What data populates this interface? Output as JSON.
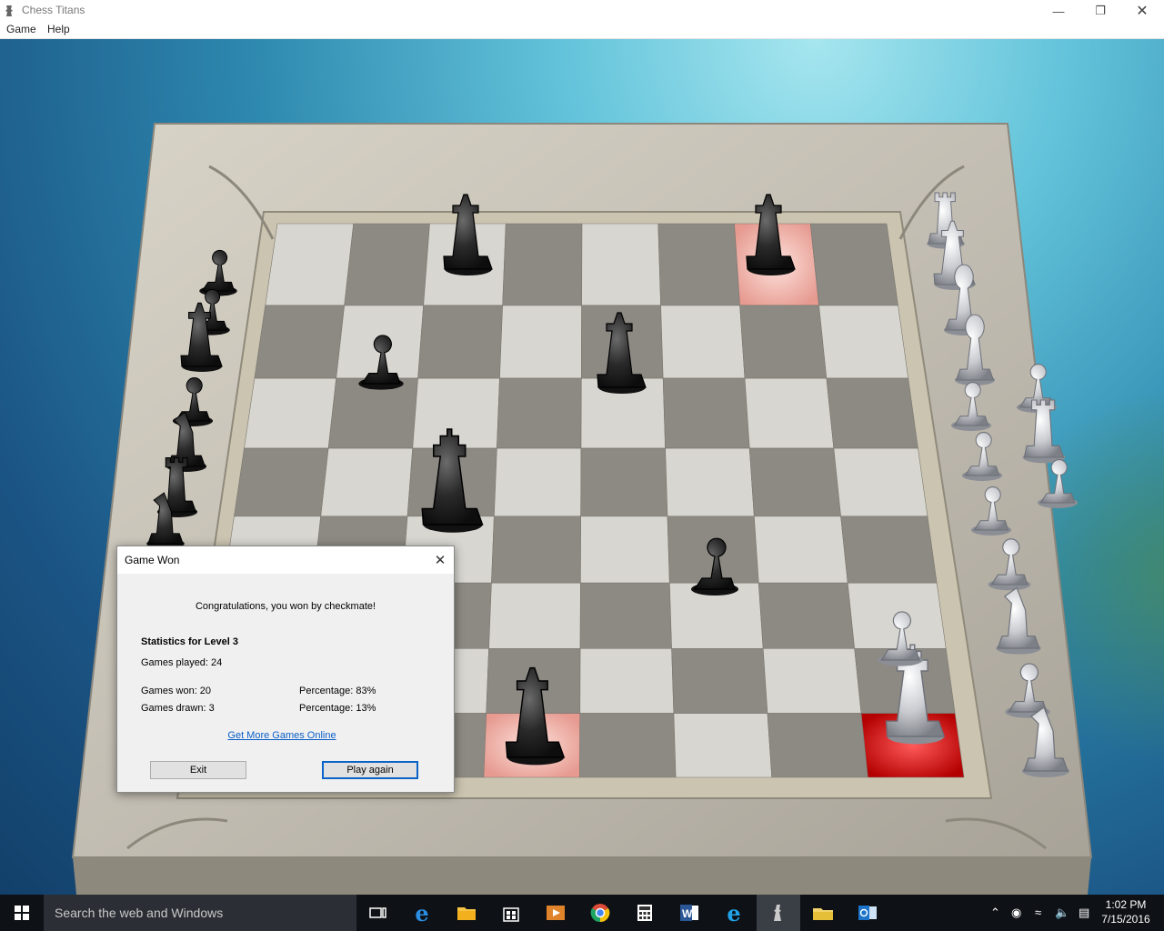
{
  "window": {
    "title": "Chess Titans",
    "minimize_icon": "minimize-icon",
    "maximize_icon": "restore-icon",
    "close_icon": "close-icon"
  },
  "menu": {
    "items": [
      "Game",
      "Help"
    ]
  },
  "dialog": {
    "title": "Game Won",
    "message": "Congratulations, you won by checkmate!",
    "stats_heading": "Statistics for Level 3",
    "games_played": "Games played: 24",
    "games_won": "Games won: 20",
    "won_percentage": "Percentage: 83%",
    "games_drawn": "Games drawn: 3",
    "drawn_percentage": "Percentage: 13%",
    "link": "Get More Games Online",
    "exit_button": "Exit",
    "play_again_button": "Play again"
  },
  "taskbar": {
    "search_placeholder": "Search the web and Windows",
    "apps": [
      "task-view-icon",
      "edge-icon",
      "file-explorer-icon",
      "store-icon",
      "media-player-icon",
      "chrome-icon",
      "calculator-icon",
      "word-icon",
      "internet-explorer-icon",
      "chess-titans-icon",
      "folder-icon",
      "outlook-icon"
    ],
    "clock_time": "1:02 PM",
    "clock_date": "7/15/2016"
  },
  "colors": {
    "highlight_red": "#c00000",
    "highlight_pink": "#f1a8a0",
    "link_blue": "#0a5fc8",
    "taskbar": "#0e1115"
  }
}
